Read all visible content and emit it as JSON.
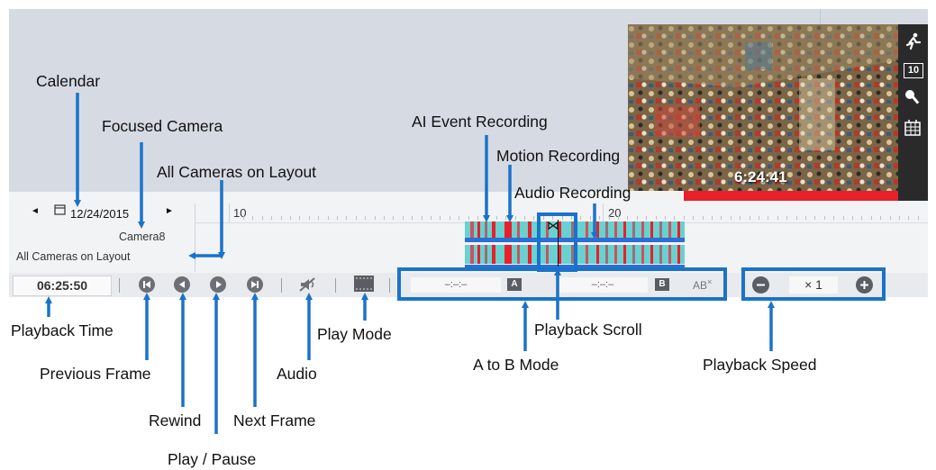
{
  "calendar": {
    "prev_label": "◄",
    "date": "12/24/2015",
    "next_label": "►"
  },
  "timeline": {
    "ticks": [
      "10",
      "20"
    ],
    "rows": [
      "Camera8",
      "All Cameras on Layout"
    ],
    "scroll_glyph": "⋈"
  },
  "video": {
    "timestamp": "6:24:41"
  },
  "sidebar": {
    "icons": [
      "running-person-icon",
      "number-10-icon",
      "key-icon",
      "calendar-grid-icon"
    ],
    "badge": "10"
  },
  "controls": {
    "time": "06:25:50",
    "ab": {
      "dash_left": "–:–:–",
      "a_label": "A",
      "dash_right": "–:–:–",
      "b_label": "B",
      "clear_label": "AB"
    },
    "speed": {
      "value": "× 1"
    }
  },
  "annotations": {
    "calendar": "Calendar",
    "focused_camera": "Focused Camera",
    "all_cameras": "All Cameras on Layout",
    "ai_event": "AI Event Recording",
    "motion": "Motion Recording",
    "audio_rec": "Audio Recording",
    "playback_time": "Playback Time",
    "previous_frame": "Previous Frame",
    "rewind": "Rewind",
    "play_pause": "Play / Pause",
    "next_frame": "Next Frame",
    "audio": "Audio",
    "play_mode": "Play Mode",
    "ab_mode": "A to B Mode",
    "playback_scroll": "Playback Scroll",
    "playback_speed": "Playback Speed"
  },
  "colors": {
    "accent": "#1a73c9",
    "track": "#69d1cf",
    "red": "#e8202a",
    "stripe": "#c9545e"
  }
}
